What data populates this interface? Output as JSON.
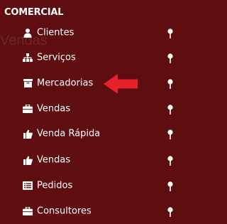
{
  "section": {
    "title": "COMERCIAL"
  },
  "menu": {
    "items": [
      {
        "label": "Clientes",
        "icon": "user-icon"
      },
      {
        "label": "Serviços",
        "icon": "sitemap-icon"
      },
      {
        "label": "Mercadorias",
        "icon": "archive-box-icon"
      },
      {
        "label": "Vendas",
        "icon": "briefcase-icon"
      },
      {
        "label": "Venda Rápida",
        "icon": "thumbs-up-icon"
      },
      {
        "label": "Vendas",
        "icon": "thumbs-up-icon"
      },
      {
        "label": "Pedidos",
        "icon": "list-alt-icon"
      },
      {
        "label": "Consultores",
        "icon": "briefcase-icon"
      }
    ]
  },
  "colors": {
    "background": "#5e0d11",
    "text": "#ffffff",
    "arrow": "#e8202a"
  }
}
